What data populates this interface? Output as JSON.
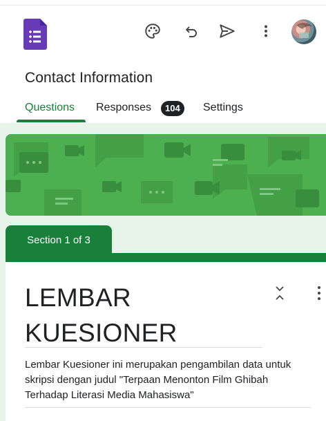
{
  "header": {
    "form_title": "Contact Information",
    "icons": [
      "forms-app-icon",
      "palette-icon",
      "undo-icon",
      "send-icon",
      "more-vert-icon",
      "avatar"
    ]
  },
  "tabs": [
    {
      "label": "Questions",
      "active": true
    },
    {
      "label": "Responses",
      "badge": "104"
    },
    {
      "label": "Settings"
    }
  ],
  "section": {
    "tab_label": "Section 1 of 3",
    "title": "LEMBAR KUESIONER",
    "description": "Lembar Kuesioner ini merupakan pengambilan data untuk skripsi dengan judul \"Terpaan Menonton Film Ghibah Terhadap Literasi Media Mahasiswa\""
  },
  "colors": {
    "accent": "#188038",
    "banner": "#4caf50",
    "app_icon": "#673ab7",
    "canvas": "#e6f4ea"
  }
}
